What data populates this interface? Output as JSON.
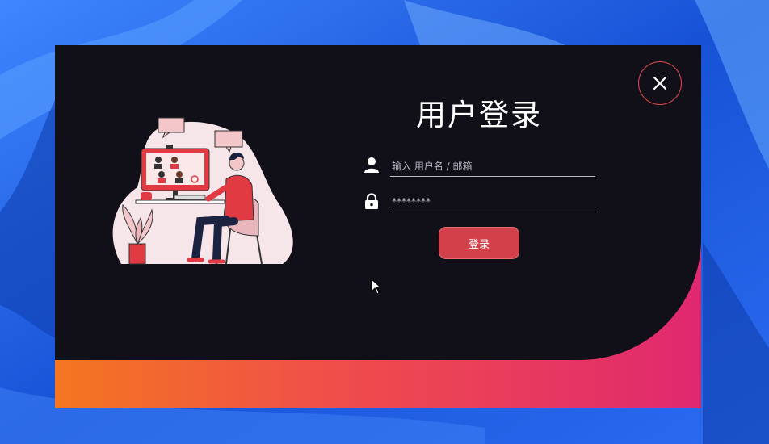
{
  "dialog": {
    "title": "用户登录",
    "username_placeholder": "输入 用户名 / 邮箱",
    "password_placeholder": "********",
    "login_label": "登录"
  },
  "icons": {
    "close": "close-icon",
    "user": "user-icon",
    "lock": "lock-icon"
  },
  "colors": {
    "panel_bg": "#111018",
    "accent": "#d2404a",
    "gradient_start": "#f47620",
    "gradient_end": "#e0286f"
  }
}
